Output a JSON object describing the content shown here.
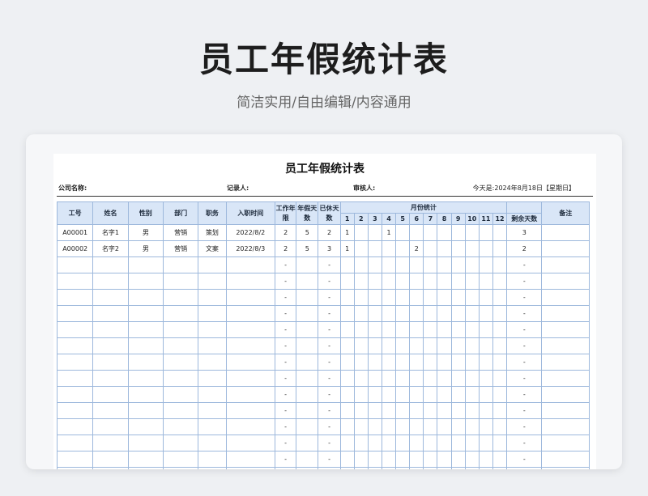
{
  "hero": {
    "title": "员工年假统计表",
    "subtitle": "简洁实用/自由编辑/内容通用"
  },
  "sheet": {
    "title": "员工年假统计表",
    "company_label": "公司名称:",
    "recorder_label": "记录人:",
    "reviewer_label": "审核人:",
    "today_text": "今天是:2024年8月18日【星期日】"
  },
  "table": {
    "headers": {
      "id": "工号",
      "name": "姓名",
      "gender": "性别",
      "dept": "部门",
      "position": "职务",
      "hire_date": "入职时间",
      "work_years": "工作年限",
      "leave_days": "年假天数",
      "used_days": "已休天数",
      "month_group": "月份统计",
      "months": [
        "1",
        "2",
        "3",
        "4",
        "5",
        "6",
        "7",
        "8",
        "9",
        "10",
        "11",
        "12"
      ],
      "remaining": "剩余天数",
      "note": "备注"
    },
    "rows": [
      {
        "id": "A00001",
        "name": "名字1",
        "gender": "男",
        "dept": "营销",
        "position": "策划",
        "hire_date": "2022/8/2",
        "work_years": "2",
        "leave_days": "5",
        "used_days": "2",
        "months": [
          "1",
          "",
          "",
          "1",
          "",
          "",
          "",
          "",
          "",
          "",
          "",
          ""
        ],
        "remaining": "3",
        "note": ""
      },
      {
        "id": "A00002",
        "name": "名字2",
        "gender": "男",
        "dept": "营销",
        "position": "文案",
        "hire_date": "2022/8/3",
        "work_years": "2",
        "leave_days": "5",
        "used_days": "3",
        "months": [
          "1",
          "",
          "",
          "",
          "",
          "2",
          "",
          "",
          "",
          "",
          "",
          ""
        ],
        "remaining": "2",
        "note": ""
      },
      {
        "id": "",
        "name": "",
        "gender": "",
        "dept": "",
        "position": "",
        "hire_date": "",
        "work_years": "-",
        "leave_days": "",
        "used_days": "-",
        "months": [
          "",
          "",
          "",
          "",
          "",
          "",
          "",
          "",
          "",
          "",
          "",
          ""
        ],
        "remaining": "-",
        "note": ""
      },
      {
        "id": "",
        "name": "",
        "gender": "",
        "dept": "",
        "position": "",
        "hire_date": "",
        "work_years": "-",
        "leave_days": "",
        "used_days": "-",
        "months": [
          "",
          "",
          "",
          "",
          "",
          "",
          "",
          "",
          "",
          "",
          "",
          ""
        ],
        "remaining": "-",
        "note": ""
      },
      {
        "id": "",
        "name": "",
        "gender": "",
        "dept": "",
        "position": "",
        "hire_date": "",
        "work_years": "-",
        "leave_days": "",
        "used_days": "-",
        "months": [
          "",
          "",
          "",
          "",
          "",
          "",
          "",
          "",
          "",
          "",
          "",
          ""
        ],
        "remaining": "-",
        "note": ""
      },
      {
        "id": "",
        "name": "",
        "gender": "",
        "dept": "",
        "position": "",
        "hire_date": "",
        "work_years": "-",
        "leave_days": "",
        "used_days": "-",
        "months": [
          "",
          "",
          "",
          "",
          "",
          "",
          "",
          "",
          "",
          "",
          "",
          ""
        ],
        "remaining": "-",
        "note": ""
      },
      {
        "id": "",
        "name": "",
        "gender": "",
        "dept": "",
        "position": "",
        "hire_date": "",
        "work_years": "-",
        "leave_days": "",
        "used_days": "-",
        "months": [
          "",
          "",
          "",
          "",
          "",
          "",
          "",
          "",
          "",
          "",
          "",
          ""
        ],
        "remaining": "-",
        "note": ""
      },
      {
        "id": "",
        "name": "",
        "gender": "",
        "dept": "",
        "position": "",
        "hire_date": "",
        "work_years": "-",
        "leave_days": "",
        "used_days": "-",
        "months": [
          "",
          "",
          "",
          "",
          "",
          "",
          "",
          "",
          "",
          "",
          "",
          ""
        ],
        "remaining": "-",
        "note": ""
      },
      {
        "id": "",
        "name": "",
        "gender": "",
        "dept": "",
        "position": "",
        "hire_date": "",
        "work_years": "-",
        "leave_days": "",
        "used_days": "-",
        "months": [
          "",
          "",
          "",
          "",
          "",
          "",
          "",
          "",
          "",
          "",
          "",
          ""
        ],
        "remaining": "-",
        "note": ""
      },
      {
        "id": "",
        "name": "",
        "gender": "",
        "dept": "",
        "position": "",
        "hire_date": "",
        "work_years": "-",
        "leave_days": "",
        "used_days": "-",
        "months": [
          "",
          "",
          "",
          "",
          "",
          "",
          "",
          "",
          "",
          "",
          "",
          ""
        ],
        "remaining": "-",
        "note": ""
      },
      {
        "id": "",
        "name": "",
        "gender": "",
        "dept": "",
        "position": "",
        "hire_date": "",
        "work_years": "-",
        "leave_days": "",
        "used_days": "-",
        "months": [
          "",
          "",
          "",
          "",
          "",
          "",
          "",
          "",
          "",
          "",
          "",
          ""
        ],
        "remaining": "-",
        "note": ""
      },
      {
        "id": "",
        "name": "",
        "gender": "",
        "dept": "",
        "position": "",
        "hire_date": "",
        "work_years": "-",
        "leave_days": "",
        "used_days": "-",
        "months": [
          "",
          "",
          "",
          "",
          "",
          "",
          "",
          "",
          "",
          "",
          "",
          ""
        ],
        "remaining": "-",
        "note": ""
      },
      {
        "id": "",
        "name": "",
        "gender": "",
        "dept": "",
        "position": "",
        "hire_date": "",
        "work_years": "-",
        "leave_days": "",
        "used_days": "-",
        "months": [
          "",
          "",
          "",
          "",
          "",
          "",
          "",
          "",
          "",
          "",
          "",
          ""
        ],
        "remaining": "-",
        "note": ""
      },
      {
        "id": "",
        "name": "",
        "gender": "",
        "dept": "",
        "position": "",
        "hire_date": "",
        "work_years": "-",
        "leave_days": "",
        "used_days": "-",
        "months": [
          "",
          "",
          "",
          "",
          "",
          "",
          "",
          "",
          "",
          "",
          "",
          ""
        ],
        "remaining": "-",
        "note": ""
      },
      {
        "id": "",
        "name": "",
        "gender": "",
        "dept": "",
        "position": "",
        "hire_date": "",
        "work_years": "-",
        "leave_days": "",
        "used_days": "-",
        "months": [
          "",
          "",
          "",
          "",
          "",
          "",
          "",
          "",
          "",
          "",
          "",
          ""
        ],
        "remaining": "-",
        "note": ""
      },
      {
        "id": "",
        "name": "",
        "gender": "",
        "dept": "",
        "position": "",
        "hire_date": "",
        "work_years": "-",
        "leave_days": "",
        "used_days": "-",
        "months": [
          "",
          "",
          "",
          "",
          "",
          "",
          "",
          "",
          "",
          "",
          "",
          ""
        ],
        "remaining": "-",
        "note": ""
      }
    ]
  },
  "colors": {
    "header_bg": "#d9e6f7",
    "grid_line": "#9db8dc",
    "highlight": "#d22"
  }
}
